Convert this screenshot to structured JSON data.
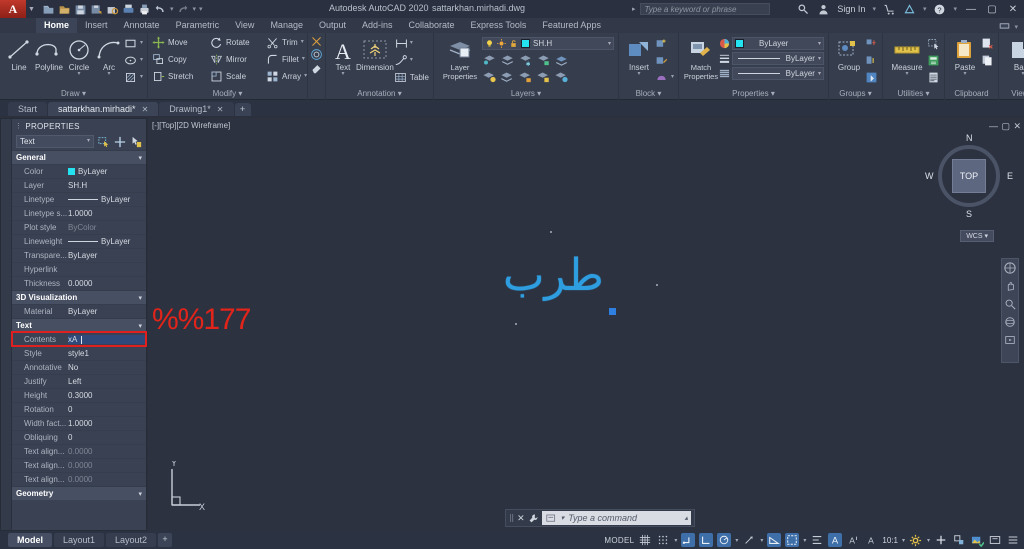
{
  "titlebar": {
    "app_title": "Autodesk AutoCAD 2020",
    "file_name": "sattarkhan.mirhadi.dwg",
    "search_placeholder": "Type a keyword or phrase",
    "sign_in": "Sign In",
    "quick_access_icons": [
      "new-icon",
      "open-icon",
      "save-icon",
      "saveas-icon",
      "plot-preview-icon",
      "plot-icon",
      "print-icon",
      "undo-icon",
      "redo-icon",
      "customize-icon"
    ],
    "right_icons": [
      "search-icon",
      "user-icon",
      "cart-icon",
      "autodesk-a-icon",
      "help-icon"
    ],
    "window_buttons": [
      "minimize",
      "maximize",
      "close"
    ]
  },
  "ribbon_tabs": {
    "items": [
      "Home",
      "Insert",
      "Annotate",
      "Parametric",
      "View",
      "Manage",
      "Output",
      "Add-ins",
      "Collaborate",
      "Express Tools",
      "Featured Apps"
    ],
    "active": "Home"
  },
  "ribbon": {
    "panels": [
      {
        "name": "Draw",
        "title": "Draw",
        "big_buttons": [
          {
            "label": "Line",
            "icon": "line-icon",
            "has_caret": false
          },
          {
            "label": "Polyline",
            "icon": "polyline-icon",
            "has_caret": false
          },
          {
            "label": "Circle",
            "icon": "circle-icon",
            "has_caret": true
          },
          {
            "label": "Arc",
            "icon": "arc-icon",
            "has_caret": true
          }
        ],
        "small_buttons": [
          {
            "icon": "rectangle-icon",
            "has_caret": true
          },
          {
            "icon": "ellipse-icon",
            "has_caret": true
          },
          {
            "icon": "hatch-icon",
            "has_caret": true
          }
        ]
      },
      {
        "name": "Modify",
        "title": "Modify",
        "rows": [
          [
            {
              "label": "Move",
              "icon": "move-icon"
            },
            {
              "label": "Rotate",
              "icon": "rotate-icon"
            },
            {
              "label": "Trim",
              "icon": "trim-icon",
              "has_caret": true
            }
          ],
          [
            {
              "label": "Copy",
              "icon": "copy-icon"
            },
            {
              "label": "Mirror",
              "icon": "mirror-icon"
            },
            {
              "label": "Fillet",
              "icon": "fillet-icon",
              "has_caret": true
            }
          ],
          [
            {
              "label": "Stretch",
              "icon": "stretch-icon"
            },
            {
              "label": "Scale",
              "icon": "scale-icon"
            },
            {
              "label": "Array",
              "icon": "array-icon",
              "has_caret": true
            }
          ]
        ],
        "extra_icons": [
          "explode-icon",
          "offset-icon",
          "erase-icon"
        ]
      },
      {
        "name": "Annotation",
        "title": "Annotation",
        "big_buttons": [
          {
            "label": "Text",
            "icon": "text-a-icon",
            "has_caret": true
          },
          {
            "label": "Dimension",
            "icon": "dimension-icon",
            "has_caret": false
          }
        ],
        "small_buttons": [
          {
            "icon": "dim-linear-icon",
            "has_caret": true
          },
          {
            "icon": "leader-icon",
            "has_caret": true
          },
          {
            "label": "Table",
            "icon": "table-icon"
          }
        ]
      },
      {
        "name": "Layers",
        "title": "Layers",
        "big_buttons": [
          {
            "label": "Layer\nProperties",
            "icon": "layer-properties-icon"
          }
        ],
        "layer_combo": {
          "value": "SH.H",
          "color": "#25e2f0",
          "icons": [
            "lightbulb-icon",
            "sun-icon",
            "unlock-icon"
          ]
        },
        "small_icons_row1": [
          "layer-isolate-icon",
          "layer-unisolate-icon",
          "layer-freeze-icon",
          "layer-lock-icon",
          "layer-merge-icon"
        ],
        "small_icons_row2": [
          "layer-on-icon",
          "layer-off-icon",
          "layer-unlock-icon",
          "layer-match-icon",
          "layer-delete-icon"
        ]
      },
      {
        "name": "Block",
        "title": "Block",
        "big_buttons": [
          {
            "label": "Insert",
            "icon": "insert-block-icon",
            "has_caret": true
          }
        ],
        "small_buttons": [
          {
            "icon": "create-block-icon"
          },
          {
            "icon": "edit-block-icon"
          },
          {
            "icon": "edit-attribute-icon",
            "has_caret": true
          }
        ]
      },
      {
        "name": "Properties",
        "title": "Properties",
        "big_buttons": [
          {
            "label": "Match\nProperties",
            "icon": "match-properties-icon"
          }
        ],
        "combos": [
          {
            "icon": "color-wheel-icon",
            "swatch": "#25e2f0",
            "value": "ByLayer"
          },
          {
            "icon": "lineweight-icon",
            "value": "ByLayer",
            "line": true
          },
          {
            "icon": "linetype-icon",
            "value": "ByLayer",
            "line": true
          }
        ]
      },
      {
        "name": "Groups",
        "title": "Groups",
        "big_buttons": [
          {
            "label": "Group",
            "icon": "group-icon"
          }
        ],
        "small_buttons": [
          {
            "icon": "ungroup-icon"
          },
          {
            "icon": "group-edit-icon"
          },
          {
            "icon": "group-selection-icon"
          }
        ]
      },
      {
        "name": "Utilities",
        "title": "Utilities",
        "big_buttons": [
          {
            "label": "Measure",
            "icon": "measure-icon",
            "has_caret": true
          }
        ],
        "small_buttons": [
          {
            "icon": "quick-select-icon"
          },
          {
            "icon": "quick-calc-icon"
          },
          {
            "icon": "point-id-icon"
          }
        ]
      },
      {
        "name": "Clipboard",
        "title": "Clipboard",
        "big_buttons": [
          {
            "label": "Paste",
            "icon": "paste-icon",
            "has_caret": true
          }
        ],
        "small_buttons": [
          {
            "icon": "cut-icon"
          },
          {
            "icon": "copy-clip-icon"
          }
        ]
      },
      {
        "name": "View",
        "title": "View",
        "big_buttons": [
          {
            "label": "Base",
            "icon": "base-view-icon",
            "has_caret": true
          }
        ]
      }
    ]
  },
  "doc_tabs": {
    "items": [
      {
        "label": "Start",
        "closable": false,
        "active": false
      },
      {
        "label": "sattarkhan.mirhadi*",
        "closable": true,
        "active": true
      },
      {
        "label": "Drawing1*",
        "closable": true,
        "active": false
      }
    ],
    "add_label": "+"
  },
  "properties_palette": {
    "title": "PROPERTIES",
    "object_type": "Text",
    "toolbar_icons": [
      "quick-select-icon",
      "pickadd-icon",
      "select-objects-icon"
    ],
    "groups": [
      {
        "name": "General",
        "rows": [
          {
            "key": "Color",
            "value": "ByLayer",
            "swatch": "#25e2f0"
          },
          {
            "key": "Layer",
            "value": "SH.H"
          },
          {
            "key": "Linetype",
            "value": "ByLayer",
            "line": true
          },
          {
            "key": "Linetype s...",
            "value": "1.0000"
          },
          {
            "key": "Plot style",
            "value": "ByColor",
            "dim": true
          },
          {
            "key": "Lineweight",
            "value": "ByLayer",
            "line": true
          },
          {
            "key": "Transpare...",
            "value": "ByLayer"
          },
          {
            "key": "Hyperlink",
            "value": ""
          },
          {
            "key": "Thickness",
            "value": "0.0000"
          }
        ]
      },
      {
        "name": "3D Visualization",
        "rows": [
          {
            "key": "Material",
            "value": "ByLayer"
          }
        ]
      },
      {
        "name": "Text",
        "rows": [
          {
            "key": "Contents",
            "value": "xA",
            "highlight": true,
            "editing": true
          },
          {
            "key": "Style",
            "value": "style1"
          },
          {
            "key": "Annotative",
            "value": "No"
          },
          {
            "key": "Justify",
            "value": "Left"
          },
          {
            "key": "Height",
            "value": "0.3000"
          },
          {
            "key": "Rotation",
            "value": "0"
          },
          {
            "key": "Width fact...",
            "value": "1.0000"
          },
          {
            "key": "Obliquing",
            "value": "0"
          },
          {
            "key": "Text align...",
            "value": "0.0000",
            "dim": true
          },
          {
            "key": "Text align...",
            "value": "0.0000",
            "dim": true
          },
          {
            "key": "Text align...",
            "value": "0.0000",
            "dim": true
          }
        ]
      },
      {
        "name": "Geometry",
        "rows": []
      }
    ]
  },
  "canvas": {
    "viewport_label": "[-][Top][2D Wireframe]",
    "drawing_text": "طرب",
    "annotation_text": "%%177",
    "annotation_color": "#e2241a",
    "text_color": "#2f9ee0",
    "viewcube": {
      "top": "TOP",
      "north": "N",
      "south": "S",
      "east": "E",
      "west": "W"
    },
    "ucs_badge": "WCS",
    "ucs_axis_y": "Y",
    "ucs_axis_x": "X",
    "viewport_buttons": [
      "minimize",
      "maximize",
      "close"
    ]
  },
  "command_line": {
    "placeholder": "Type a command",
    "icons": [
      "close-icon",
      "wrench-icon",
      "command-history-icon",
      "chevron-up-icon"
    ]
  },
  "statusbar": {
    "layout_tabs": [
      {
        "label": "Model",
        "active": true
      },
      {
        "label": "Layout1",
        "active": false
      },
      {
        "label": "Layout2",
        "active": false
      }
    ],
    "add_layout": "+",
    "model_label": "MODEL",
    "scale": "10:1",
    "toggles": [
      {
        "name": "grid-display-icon",
        "on": false
      },
      {
        "name": "snap-mode-icon",
        "on": false
      },
      {
        "name": "infer-constraints-icon",
        "on": true
      },
      {
        "name": "ortho-mode-icon",
        "on": true
      },
      {
        "name": "polar-tracking-icon",
        "on": true
      },
      {
        "name": "object-snap-tracking-icon",
        "on": false
      },
      {
        "name": "object-snap-icon",
        "on": true
      },
      {
        "name": "lineweight-icon",
        "on": true
      },
      {
        "name": "transparency-icon",
        "on": false
      },
      {
        "name": "selection-cycling-icon",
        "on": false
      },
      {
        "name": "annotation-visibility-icon",
        "on": true
      },
      {
        "name": "autoscale-icon",
        "on": false
      },
      {
        "name": "annotation-scale-icon",
        "on": false
      },
      {
        "name": "workspace-switching-icon",
        "on": false
      },
      {
        "name": "hardware-acceleration-icon",
        "on": false
      },
      {
        "name": "isolate-objects-icon",
        "on": false
      },
      {
        "name": "clean-screen-icon",
        "on": false
      },
      {
        "name": "customization-icon",
        "on": false
      }
    ]
  }
}
